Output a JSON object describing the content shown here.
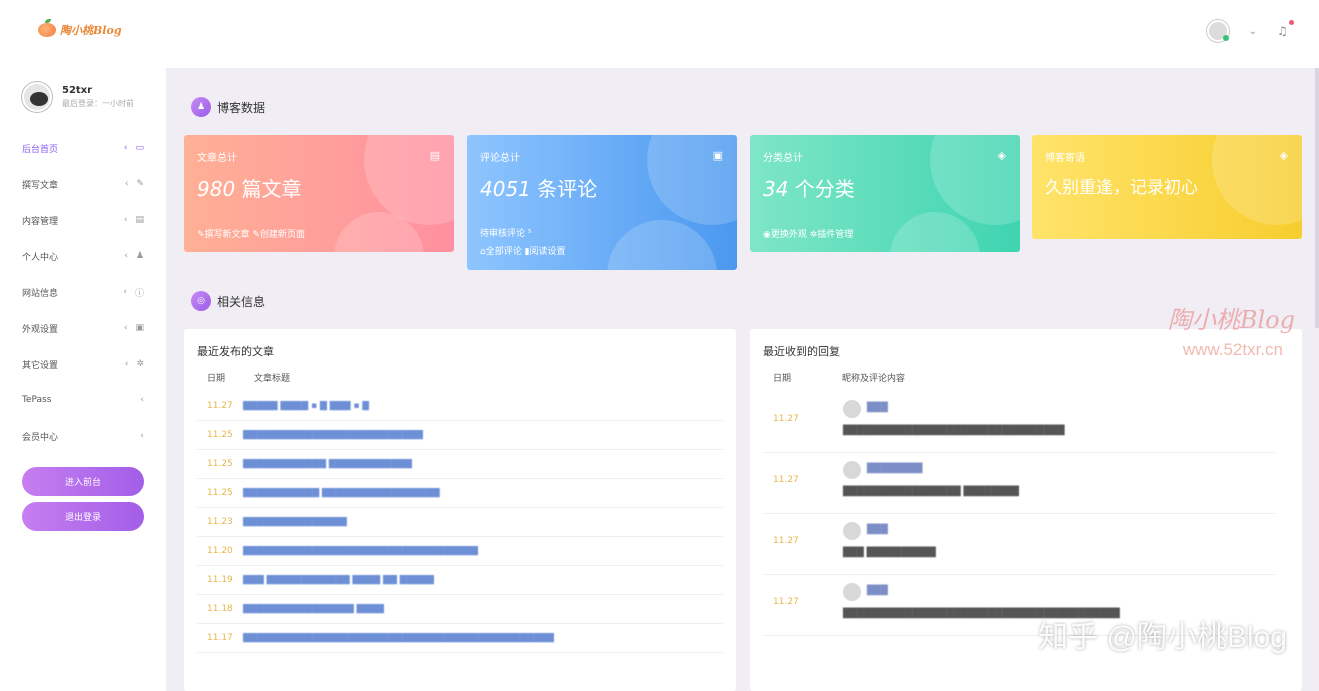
{
  "header": {
    "logo_text": "陶小桃Blog",
    "user_caret": "⌄",
    "bell": "🔔"
  },
  "user": {
    "name": "52txr",
    "sub": "最后登录：一小时前"
  },
  "sidebar": {
    "items": [
      {
        "label": "后台首页",
        "icon": "monitor-icon",
        "glyph": "▭"
      },
      {
        "label": "撰写文章",
        "icon": "pencil-icon",
        "glyph": "✎"
      },
      {
        "label": "内容管理",
        "icon": "book-icon",
        "glyph": "▤"
      },
      {
        "label": "个人中心",
        "icon": "user-icon",
        "glyph": "♟"
      },
      {
        "label": "网站信息",
        "icon": "info-icon",
        "glyph": "ⓘ"
      },
      {
        "label": "外观设置",
        "icon": "image-icon",
        "glyph": "▣"
      },
      {
        "label": "其它设置",
        "icon": "gear-icon",
        "glyph": "✲"
      },
      {
        "label": "TePass",
        "icon": "",
        "glyph": ""
      },
      {
        "label": "会员中心",
        "icon": "",
        "glyph": ""
      }
    ],
    "chevron": "‹",
    "enter_front": "进入前台",
    "logout": "退出登录"
  },
  "section1": {
    "title": "博客数据",
    "icon": "♟"
  },
  "cards": [
    {
      "label": "文章总计",
      "num": "980",
      "unit": " 篇文章",
      "icon": "▤",
      "links": "✎撰写新文章 ✎创建新页面",
      "pending": ""
    },
    {
      "label": "评论总计",
      "num": "4051",
      "unit": " 条评论",
      "icon": "▣",
      "pending": "待审核评论 ⁵",
      "links": "⌂全部评论 ▮阅读设置"
    },
    {
      "label": "分类总计",
      "num": "34",
      "unit": " 个分类",
      "icon": "◈",
      "links": "◉更换外观 ✲插件管理",
      "pending": ""
    },
    {
      "label": "博客寄语",
      "num": "",
      "unit": "久别重逢，记录初心",
      "icon": "◈",
      "links": "",
      "pending": ""
    }
  ],
  "section2": {
    "title": "相关信息",
    "icon": "◎"
  },
  "recent_posts": {
    "title": "最近发布的文章",
    "col_date": "日期",
    "col_title": "文章标题",
    "rows": [
      {
        "date": "11.27",
        "title": "█████ ████ ▪ █ ███ ▪ █"
      },
      {
        "date": "11.25",
        "title": "██████████████████████████"
      },
      {
        "date": "11.25",
        "title": "████████████ ████████████"
      },
      {
        "date": "11.25",
        "title": "███████████ █████████████████"
      },
      {
        "date": "11.23",
        "title": "███████████████"
      },
      {
        "date": "11.20",
        "title": "██████████████████████████████████"
      },
      {
        "date": "11.19",
        "title": "███ ████████████ ████ ██ █████"
      },
      {
        "date": "11.18",
        "title": "████████████████ ████"
      },
      {
        "date": "11.17",
        "title": "█████████████████████████████████████████████"
      }
    ]
  },
  "recent_replies": {
    "title": "最近收到的回复",
    "col_date": "日期",
    "col_content": "昵称及评论内容",
    "rows": [
      {
        "date": "11.27",
        "name": "███",
        "content": "████████████████████████████████"
      },
      {
        "date": "11.27",
        "name": "████████",
        "content": "█████████████████ ████████"
      },
      {
        "date": "11.27",
        "name": "███",
        "content": "███ ██████████"
      },
      {
        "date": "11.27",
        "name": "███",
        "content": "████████████████████████████████████████"
      }
    ]
  },
  "watermarks": {
    "brand": "陶小桃Blog",
    "url": "www.52txr.cn",
    "zhihu": "知乎 @陶小桃Blog"
  }
}
